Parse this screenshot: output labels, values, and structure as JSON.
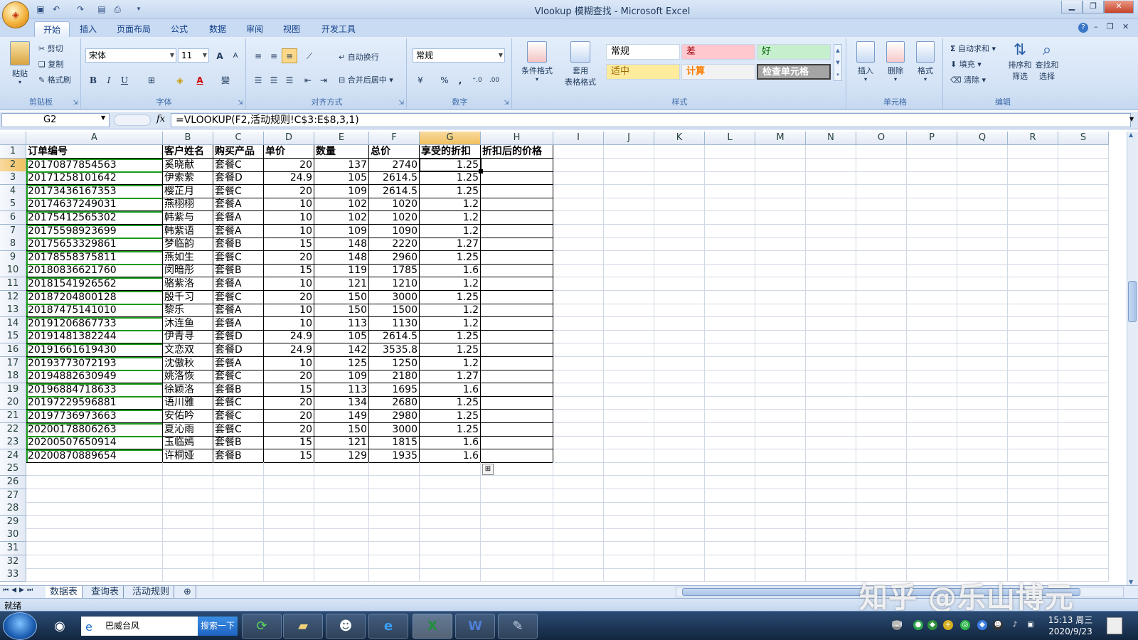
{
  "window": {
    "title": "Vlookup 模糊查找 - Microsoft Excel",
    "min": "▁",
    "max": "❐",
    "close": "✕"
  },
  "ribbon_tabs": [
    "开始",
    "插入",
    "页面布局",
    "公式",
    "数据",
    "审阅",
    "视图",
    "开发工具"
  ],
  "clipboard": {
    "paste": "粘贴",
    "cut": "剪切",
    "copy": "复制",
    "format_painter": "格式刷",
    "label": "剪贴板"
  },
  "font": {
    "name": "宋体",
    "size": "11",
    "label": "字体",
    "bold": "B",
    "italic": "I",
    "underline": "U",
    "grow": "A",
    "shrink": "A",
    "font_color_glyph": "A",
    "phonetic": "變"
  },
  "alignment": {
    "wrap": "自动换行",
    "merge": "合并后居中",
    "label": "对齐方式"
  },
  "number": {
    "format": "常规",
    "label": "数字",
    "percent": "%",
    "comma": ",",
    "inc_decimal": "⁺.0",
    "dec_decimal": ".00"
  },
  "styles": {
    "conditional": "条件格式",
    "table_format_1": "套用",
    "table_format_2": "表格格式",
    "label": "样式",
    "cells": [
      {
        "text": "常规",
        "bg": "#ffffff",
        "fg": "#000000"
      },
      {
        "text": "差",
        "bg": "#ffc7ce",
        "fg": "#9c0006"
      },
      {
        "text": "好",
        "bg": "#c6efce",
        "fg": "#006100"
      },
      {
        "text": "适中",
        "bg": "#ffeb9c",
        "fg": "#9c6500"
      },
      {
        "text": "计算",
        "bg": "#f2f2f2",
        "fg": "#fa7d00"
      },
      {
        "text": "检查单元格",
        "bg": "#a5a5a5",
        "fg": "#ffffff"
      }
    ]
  },
  "cells_group": {
    "insert": "插入",
    "delete": "删除",
    "format": "格式",
    "label": "单元格"
  },
  "editing": {
    "autosum": "自动求和",
    "fill": "填充",
    "clear": "清除",
    "sort_1": "排序和",
    "sort_2": "筛选",
    "find_1": "查找和",
    "find_2": "选择",
    "label": "编辑"
  },
  "formula_bar": {
    "name_box": "G2",
    "fx": "fx",
    "formula": "=VLOOKUP(F2,活动规则!C$3:E$8,3,1)"
  },
  "columns": [
    "A",
    "B",
    "C",
    "D",
    "E",
    "F",
    "G",
    "H",
    "I",
    "J",
    "K",
    "L",
    "M",
    "N",
    "O",
    "P",
    "Q",
    "R",
    "S"
  ],
  "row_numbers": [
    "1",
    "2",
    "3",
    "4",
    "5",
    "6",
    "7",
    "8",
    "9",
    "10",
    "11",
    "12",
    "13",
    "14",
    "15",
    "16",
    "17",
    "18",
    "19",
    "20",
    "21",
    "22",
    "23",
    "24",
    "25",
    "26",
    "27",
    "28",
    "29",
    "30",
    "31",
    "32",
    "33"
  ],
  "headers": [
    "订单编号",
    "客户姓名",
    "购买产品",
    "单价",
    "数量",
    "总价",
    "享受的折扣",
    "折扣后的价格"
  ],
  "rows": [
    [
      "20170877854563",
      "奚晓献",
      "套餐C",
      "20",
      "137",
      "2740",
      "1.25"
    ],
    [
      "20171258101642",
      "伊索萦",
      "套餐D",
      "24.9",
      "105",
      "2614.5",
      "1.25"
    ],
    [
      "20173436167353",
      "樱芷月",
      "套餐C",
      "20",
      "109",
      "2614.5",
      "1.25"
    ],
    [
      "20174637249031",
      "燕栩栩",
      "套餐A",
      "10",
      "102",
      "1020",
      "1.2"
    ],
    [
      "20175412565302",
      "韩紫与",
      "套餐A",
      "10",
      "102",
      "1020",
      "1.2"
    ],
    [
      "20175598923699",
      "韩紫语",
      "套餐A",
      "10",
      "109",
      "1090",
      "1.2"
    ],
    [
      "20175653329861",
      "梦临韵",
      "套餐B",
      "15",
      "148",
      "2220",
      "1.27"
    ],
    [
      "20178558375811",
      "燕如生",
      "套餐C",
      "20",
      "148",
      "2960",
      "1.25"
    ],
    [
      "20180836621760",
      "闵暗彤",
      "套餐B",
      "15",
      "119",
      "1785",
      "1.6"
    ],
    [
      "20181541926562",
      "骆紫洛",
      "套餐A",
      "10",
      "121",
      "1210",
      "1.2"
    ],
    [
      "20187204800128",
      "殷千习",
      "套餐C",
      "20",
      "150",
      "3000",
      "1.25"
    ],
    [
      "20187475141010",
      "黎乐",
      "套餐A",
      "10",
      "150",
      "1500",
      "1.2"
    ],
    [
      "20191206867733",
      "沐连鱼",
      "套餐A",
      "10",
      "113",
      "1130",
      "1.2"
    ],
    [
      "20191481382244",
      "伊青寻",
      "套餐D",
      "24.9",
      "105",
      "2614.5",
      "1.25"
    ],
    [
      "20191661619430",
      "文恋双",
      "套餐D",
      "24.9",
      "142",
      "3535.8",
      "1.25"
    ],
    [
      "20193773072193",
      "沈傲秋",
      "套餐A",
      "10",
      "125",
      "1250",
      "1.2"
    ],
    [
      "20194882630949",
      "姚洛恢",
      "套餐C",
      "20",
      "109",
      "2180",
      "1.27"
    ],
    [
      "20196884718633",
      "徐颖洛",
      "套餐B",
      "15",
      "113",
      "1695",
      "1.6"
    ],
    [
      "20197229596881",
      "语川雅",
      "套餐C",
      "20",
      "134",
      "2680",
      "1.25"
    ],
    [
      "20197736973663",
      "安佑吟",
      "套餐C",
      "20",
      "149",
      "2980",
      "1.25"
    ],
    [
      "20200178806263",
      "夏沁雨",
      "套餐C",
      "20",
      "150",
      "3000",
      "1.25"
    ],
    [
      "20200507650914",
      "玉临嫣",
      "套餐B",
      "15",
      "121",
      "1815",
      "1.6"
    ],
    [
      "20200870889654",
      "许桐娅",
      "套餐B",
      "15",
      "129",
      "1935",
      "1.6"
    ]
  ],
  "sheet_tabs": [
    "数据表",
    "查询表",
    "活动规则"
  ],
  "status": {
    "ready": "就绪"
  },
  "watermark": "知乎 @乐山博元",
  "taskbar": {
    "search_text": "巴威台风",
    "search_button": "搜索一下",
    "time": "15:13 周三",
    "date": "2020/9/23"
  }
}
